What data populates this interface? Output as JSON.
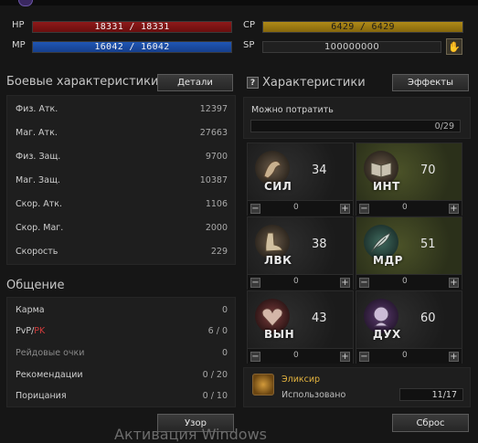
{
  "vitals": {
    "hp_label": "HP",
    "hp_value": "18331 / 18331",
    "mp_label": "MP",
    "mp_value": "16042 / 16042",
    "cp_label": "CP",
    "cp_value": "6429 / 6429",
    "sp_label": "SP",
    "sp_value": "100000000"
  },
  "combat": {
    "title": "Боевые характеристики",
    "details_button": "Детали",
    "rows": [
      {
        "label": "Физ. Атк.",
        "value": "12397"
      },
      {
        "label": "Маг. Атк.",
        "value": "27663"
      },
      {
        "label": "Физ. Защ.",
        "value": "9700"
      },
      {
        "label": "Маг. Защ.",
        "value": "10387"
      },
      {
        "label": "Скор. Атк.",
        "value": "1106"
      },
      {
        "label": "Скор. Маг.",
        "value": "2000"
      },
      {
        "label": "Скорость",
        "value": "229"
      }
    ]
  },
  "social": {
    "title": "Общение",
    "rows": [
      {
        "label": "Карма",
        "value": "0"
      },
      {
        "label_pvp": "PvP",
        "label_sep": "/",
        "label_pk": "PK",
        "value": "6 / 0"
      },
      {
        "label": "Рейдовые очки",
        "value": "0"
      },
      {
        "label": "Рекомендации",
        "value": "0 / 20"
      },
      {
        "label": "Порицания",
        "value": "0 / 10"
      }
    ]
  },
  "stats": {
    "help_icon": "?",
    "title": "Характеристики",
    "effects_button": "Эффекты",
    "can_spend_label": "Можно потратить",
    "can_spend_value": "0/29",
    "cells": [
      {
        "abbr": "СИЛ",
        "value": "34",
        "added": "0",
        "icon": "arm-icon"
      },
      {
        "abbr": "ИНТ",
        "value": "70",
        "added": "0",
        "icon": "book-icon"
      },
      {
        "abbr": "ЛВК",
        "value": "38",
        "added": "0",
        "icon": "foot-icon"
      },
      {
        "abbr": "МДР",
        "value": "51",
        "added": "0",
        "icon": "feather-icon"
      },
      {
        "abbr": "ВЫН",
        "value": "43",
        "added": "0",
        "icon": "heart-icon"
      },
      {
        "abbr": "ДУХ",
        "value": "60",
        "added": "0",
        "icon": "spirit-icon"
      }
    ],
    "elixir_label": "Эликсир",
    "elixir_used_label": "Использовано",
    "elixir_used_value": "11/17"
  },
  "footer": {
    "pattern_button": "Узор",
    "reset_button": "Сброс",
    "watermark": "Активация Windows"
  },
  "colors": {
    "hp": "#8e1a1a",
    "mp": "#1f56b4",
    "cp": "#b08a18",
    "pk": "#d23b3b",
    "elixir": "#e3b33f"
  }
}
